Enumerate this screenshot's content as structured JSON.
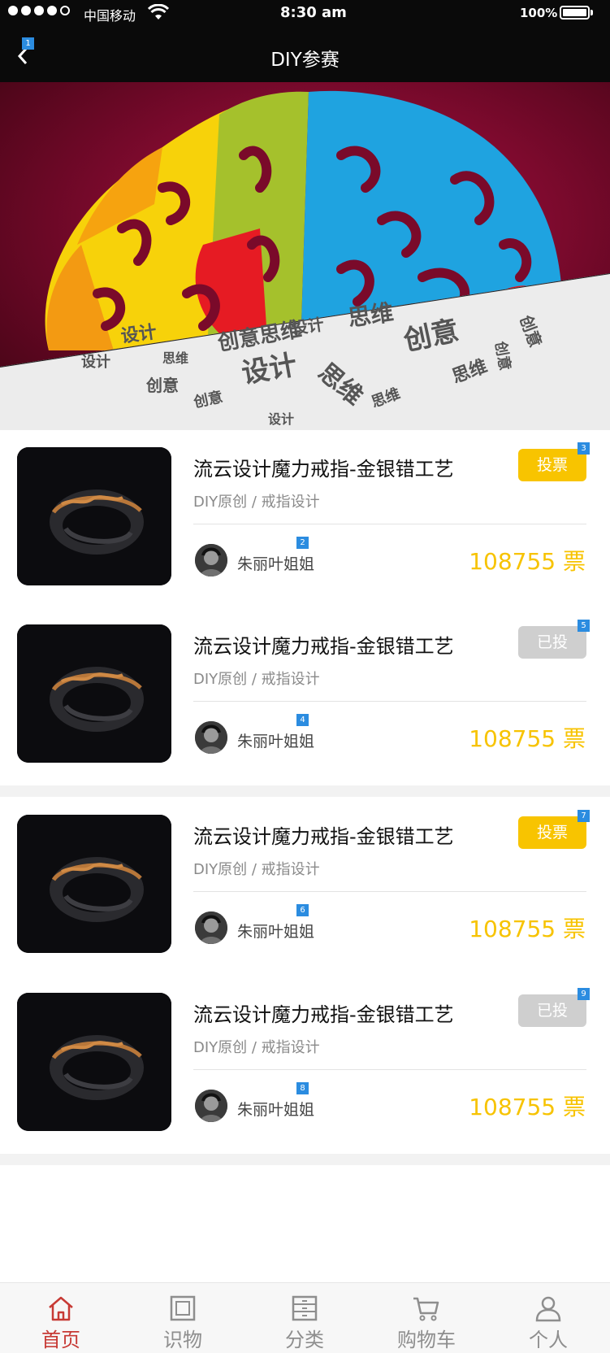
{
  "status": {
    "carrier": "中国移动",
    "time": "8:30 am",
    "battery": "100%"
  },
  "nav": {
    "title": "DIY参赛",
    "back_badge": "1"
  },
  "banner": {
    "words": [
      "设计",
      "创意",
      "思维",
      "创意思维",
      "设计",
      "思维",
      "创意",
      "设计",
      "思维",
      "创意",
      "设计",
      "创意",
      "思维",
      "设计",
      "创意",
      "思维"
    ]
  },
  "items": [
    {
      "title": "流云设计魔力戒指-金银错工艺",
      "subtitle": "DIY原创 / 戒指设计",
      "author": "朱丽叶姐姐",
      "votes": "108755 票",
      "button": "投票",
      "state": "active",
      "author_badge": "2",
      "button_badge": "3"
    },
    {
      "title": "流云设计魔力戒指-金银错工艺",
      "subtitle": "DIY原创 / 戒指设计",
      "author": "朱丽叶姐姐",
      "votes": "108755 票",
      "button": "已投",
      "state": "voted",
      "author_badge": "4",
      "button_badge": "5"
    },
    {
      "title": "流云设计魔力戒指-金银错工艺",
      "subtitle": "DIY原创 / 戒指设计",
      "author": "朱丽叶姐姐",
      "votes": "108755 票",
      "button": "投票",
      "state": "active",
      "author_badge": "6",
      "button_badge": "7"
    },
    {
      "title": "流云设计魔力戒指-金银错工艺",
      "subtitle": "DIY原创 / 戒指设计",
      "author": "朱丽叶姐姐",
      "votes": "108755 票",
      "button": "已投",
      "state": "voted",
      "author_badge": "8",
      "button_badge": "9"
    }
  ],
  "tabbar": {
    "tabs": [
      {
        "label": "首页",
        "icon": "home-icon",
        "active": true
      },
      {
        "label": "识物",
        "icon": "frame-icon",
        "active": false
      },
      {
        "label": "分类",
        "icon": "cabinet-icon",
        "active": false
      },
      {
        "label": "购物车",
        "icon": "cart-icon",
        "active": false
      },
      {
        "label": "个人",
        "icon": "person-icon",
        "active": false
      }
    ]
  },
  "colors": {
    "accent": "#f8c400",
    "vote_text": "#f7c300",
    "voted_gray": "#cfcfcf",
    "tab_active": "#c73a35",
    "badge": "#2b8ce0"
  }
}
